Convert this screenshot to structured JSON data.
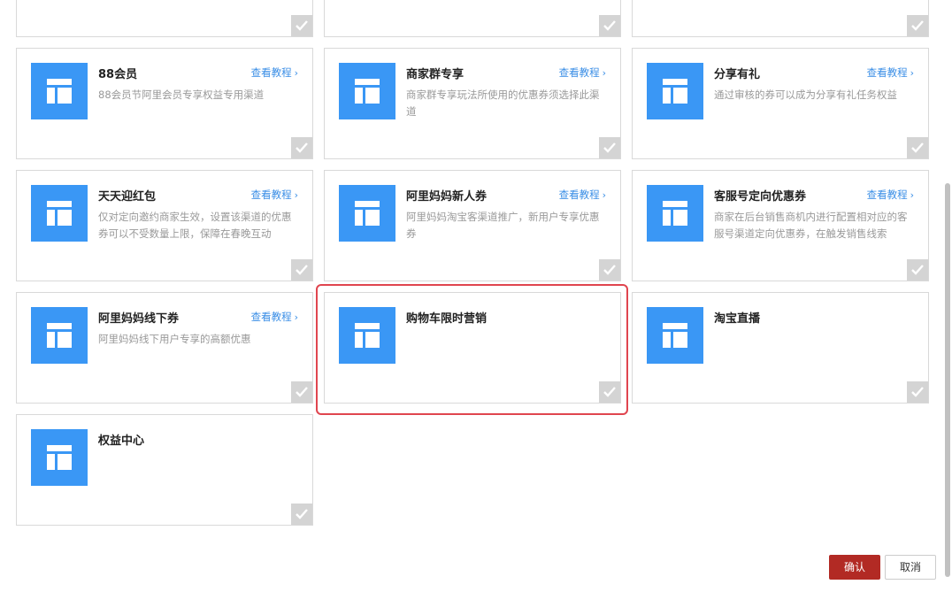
{
  "link_text": "查看教程",
  "link_chevron": "›",
  "accent_color": "#3a97f5",
  "cards": [
    {
      "title": "",
      "desc": "",
      "link": "",
      "selected_highlight": false
    },
    {
      "title": "",
      "desc": "",
      "link": "",
      "selected_highlight": false
    },
    {
      "title": "",
      "desc": "",
      "link": "",
      "selected_highlight": false
    },
    {
      "title": "88会员",
      "desc": "88会员节阿里会员专享权益专用渠道",
      "link": "查看教程"
    },
    {
      "title": "商家群专享",
      "desc": "商家群专享玩法所使用的优惠券须选择此渠道",
      "link": "查看教程"
    },
    {
      "title": "分享有礼",
      "desc": "通过审核的券可以成为分享有礼任务权益",
      "link": "查看教程"
    },
    {
      "title": "天天迎红包",
      "desc": "仅对定向邀约商家生效，设置该渠道的优惠券可以不受数量上限，保障在春晚互动",
      "link": "查看教程"
    },
    {
      "title": "阿里妈妈新人券",
      "desc": "阿里妈妈淘宝客渠道推广，新用户专享优惠券",
      "link": "查看教程"
    },
    {
      "title": "客服号定向优惠券",
      "desc": "商家在后台销售商机内进行配置相对应的客服号渠道定向优惠券，在触发销售线索",
      "link": "查看教程"
    },
    {
      "title": "阿里妈妈线下券",
      "desc": "阿里妈妈线下用户专享的高额优惠",
      "link": "查看教程"
    },
    {
      "title": "购物车限时营销",
      "desc": "",
      "link": ""
    },
    {
      "title": "淘宝直播",
      "desc": "",
      "link": ""
    },
    {
      "title": "权益中心",
      "desc": "",
      "link": ""
    }
  ],
  "footer": {
    "confirm_label": "确认",
    "cancel_label": "取消"
  }
}
